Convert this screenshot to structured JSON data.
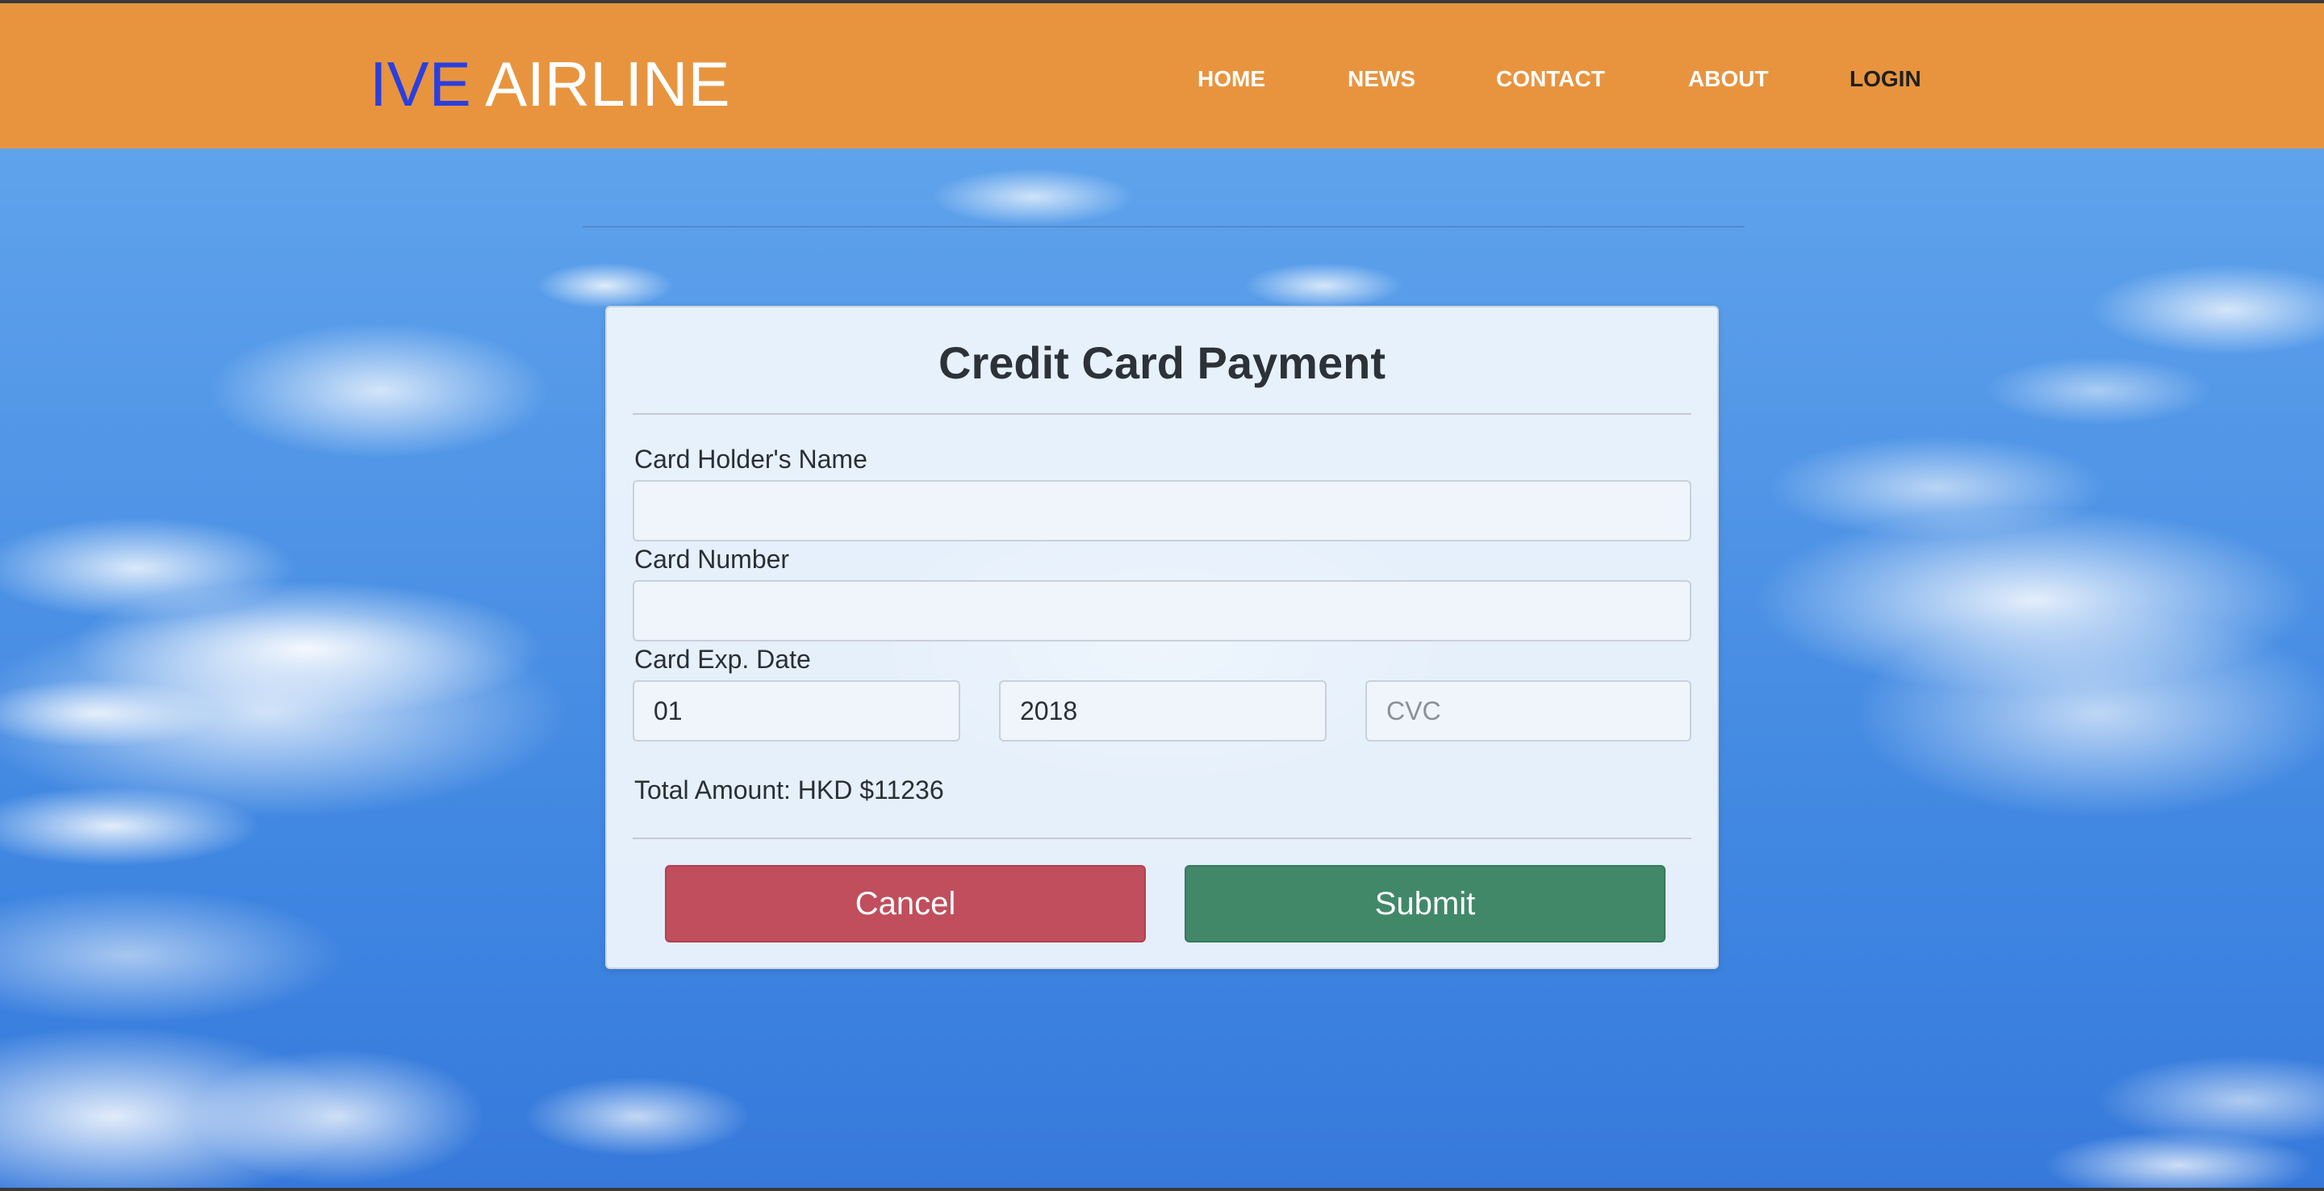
{
  "brand": {
    "part1": "IVE",
    "part2": " AIRLINE"
  },
  "nav": {
    "items": [
      {
        "label": "HOME"
      },
      {
        "label": "NEWS"
      },
      {
        "label": "CONTACT"
      },
      {
        "label": "ABOUT"
      },
      {
        "label": "LOGIN"
      }
    ]
  },
  "form": {
    "title": "Credit Card Payment",
    "holder_label": "Card Holder's Name",
    "holder_value": "",
    "number_label": "Card Number",
    "number_value": "",
    "exp_label": "Card Exp. Date",
    "exp_month": "01",
    "exp_year": "2018",
    "cvc_placeholder": "CVC",
    "total": "Total Amount: HKD $11236",
    "cancel_label": "Cancel",
    "submit_label": "Submit"
  },
  "colors": {
    "navbar": "#e8943f",
    "brand_accent": "#2a3fe0",
    "cancel": "#c04e5c",
    "submit": "#418869"
  }
}
